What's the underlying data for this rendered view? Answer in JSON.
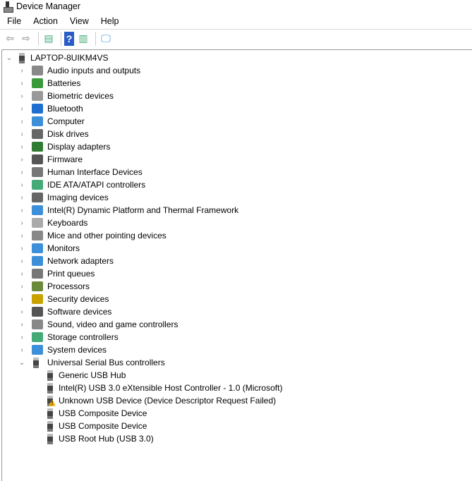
{
  "window": {
    "title": "Device Manager"
  },
  "menu": [
    "File",
    "Action",
    "View",
    "Help"
  ],
  "toolbar": [
    {
      "icon": "back-arrow-icon",
      "glyph": "⇦"
    },
    {
      "icon": "forward-arrow-icon",
      "glyph": "⇨"
    },
    {
      "icon": "properties-icon",
      "glyph": "▤"
    },
    {
      "icon": "help-icon",
      "glyph": "?"
    },
    {
      "icon": "run-icon",
      "glyph": "▥"
    },
    {
      "icon": "scan-hardware-icon",
      "glyph": "🖵"
    }
  ],
  "tree": {
    "root": "LAPTOP-8UIKM4VS",
    "categories": [
      {
        "label": "Audio inputs and outputs",
        "color": "#888"
      },
      {
        "label": "Batteries",
        "color": "#3a9a3a"
      },
      {
        "label": "Biometric devices",
        "color": "#999"
      },
      {
        "label": "Bluetooth",
        "color": "#1f6fd0"
      },
      {
        "label": "Computer",
        "color": "#3c8fd8"
      },
      {
        "label": "Disk drives",
        "color": "#666"
      },
      {
        "label": "Display adapters",
        "color": "#2e7d32"
      },
      {
        "label": "Firmware",
        "color": "#555"
      },
      {
        "label": "Human Interface Devices",
        "color": "#777"
      },
      {
        "label": "IDE ATA/ATAPI controllers",
        "color": "#4a7"
      },
      {
        "label": "Imaging devices",
        "color": "#666"
      },
      {
        "label": "Intel(R) Dynamic Platform and Thermal Framework",
        "color": "#3c8fd8"
      },
      {
        "label": "Keyboards",
        "color": "#aaa"
      },
      {
        "label": "Mice and other pointing devices",
        "color": "#888"
      },
      {
        "label": "Monitors",
        "color": "#3c8fd8"
      },
      {
        "label": "Network adapters",
        "color": "#3c8fd8"
      },
      {
        "label": "Print queues",
        "color": "#777"
      },
      {
        "label": "Processors",
        "color": "#6a8a3a"
      },
      {
        "label": "Security devices",
        "color": "#c9a200"
      },
      {
        "label": "Software devices",
        "color": "#555"
      },
      {
        "label": "Sound, video and game controllers",
        "color": "#888"
      },
      {
        "label": "Storage controllers",
        "color": "#4a7"
      },
      {
        "label": "System devices",
        "color": "#3c8fd8"
      }
    ],
    "expanded": {
      "label": "Universal Serial Bus controllers",
      "children": [
        {
          "label": "Generic USB Hub",
          "warning": false
        },
        {
          "label": "Intel(R) USB 3.0 eXtensible Host Controller - 1.0 (Microsoft)",
          "warning": false
        },
        {
          "label": "Unknown USB Device (Device Descriptor Request Failed)",
          "warning": true
        },
        {
          "label": "USB Composite Device",
          "warning": false
        },
        {
          "label": "USB Composite Device",
          "warning": false
        },
        {
          "label": "USB Root Hub (USB 3.0)",
          "warning": false
        }
      ]
    }
  }
}
